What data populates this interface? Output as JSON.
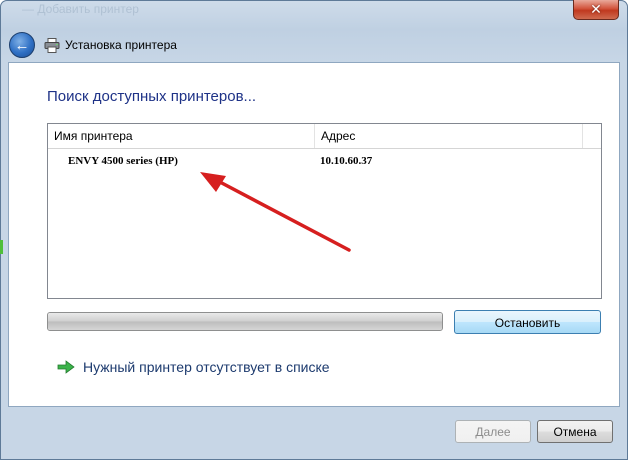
{
  "window": {
    "faint_title": "— Добавить принтер",
    "close_glyph": "✕"
  },
  "nav": {
    "back_icon": "back-arrow-icon",
    "back_glyph": "←",
    "title": "Установка принтера"
  },
  "main": {
    "heading": "Поиск доступных принтеров...",
    "columns": [
      "Имя принтера",
      "Адрес"
    ],
    "rows": [
      {
        "name": "ENVY 4500 series (HP)",
        "address": "10.10.60.37"
      }
    ],
    "progress": 1.0,
    "stop_button": "Остановить",
    "missing_printer_link": "Нужный принтер отсутствует в списке"
  },
  "footer": {
    "next_button": "Далее",
    "cancel_button": "Отмена"
  },
  "colors": {
    "heading": "#1e3287",
    "annotation_arrow": "#d61f1f",
    "link_arrow": "#3bb34a"
  }
}
